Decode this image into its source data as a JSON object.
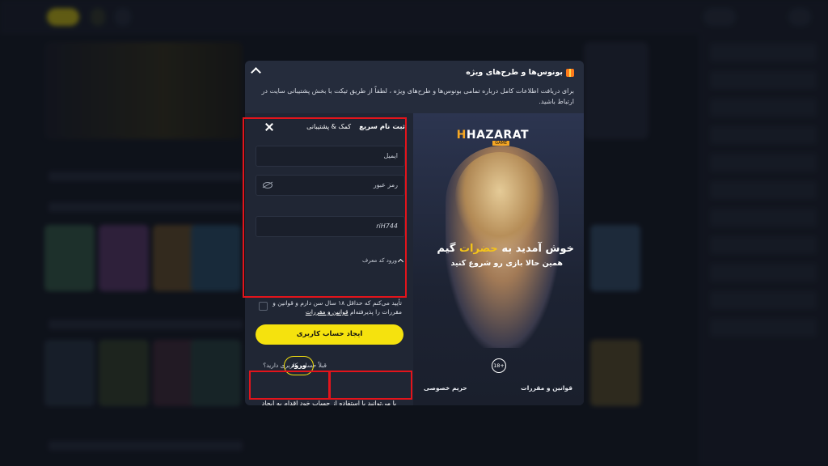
{
  "modal": {
    "notice": {
      "title": "بونوس‌ها و طرح‌های ویژه",
      "text": "برای دریافت اطلاعات کامل درباره تمامی بونوس‌ها و طرح‌های ویژه ، لطفاً از طریق تیکت با بخش پشتیبانی سایت در ارتباط باشید."
    },
    "form": {
      "tab_signup": "ثبت نام سریع",
      "tab_help": "کمک & پشتیبانی",
      "email_placeholder": "ایمیل",
      "password_placeholder": "رمز عبور",
      "referral_label": "ورود کد معرف",
      "referral_value": "riH744",
      "terms_text": "تأیید می‌کنم که حداقل ۱۸ سال سن دارم و قوانین و مقررات را پذیرفته‌ام",
      "terms_link": "قوانین و مقررات",
      "create_button": "ایجاد حساب کاربری",
      "have_account": "قبلاً حساب کاربری دارید؟",
      "login_button": "ورود",
      "social_text": "یا می‌توانید با استفاده از حساب خود اقدام به ایجاد حساب کنید"
    },
    "promo": {
      "logo": "HAZARAT",
      "logo_sub": "GAME",
      "title_prefix": "خوش آمدید به",
      "title_highlight": "حضرات",
      "title_suffix": "گیم",
      "subtitle": "همین حالا بازی رو شروع کنید",
      "age_badge": "18+",
      "footer_terms": "قوانین و مقررات",
      "footer_privacy": "حریم خصوصی"
    }
  },
  "colors": {
    "accent_yellow": "#f5e20e",
    "highlight_red": "#e3141b",
    "modal_bg": "#202634"
  },
  "icons": [
    "gift-icon",
    "chevron-up-icon",
    "close-icon",
    "eye-off-icon",
    "chevron-up-small-icon",
    "google-icon",
    "telegram-icon"
  ]
}
